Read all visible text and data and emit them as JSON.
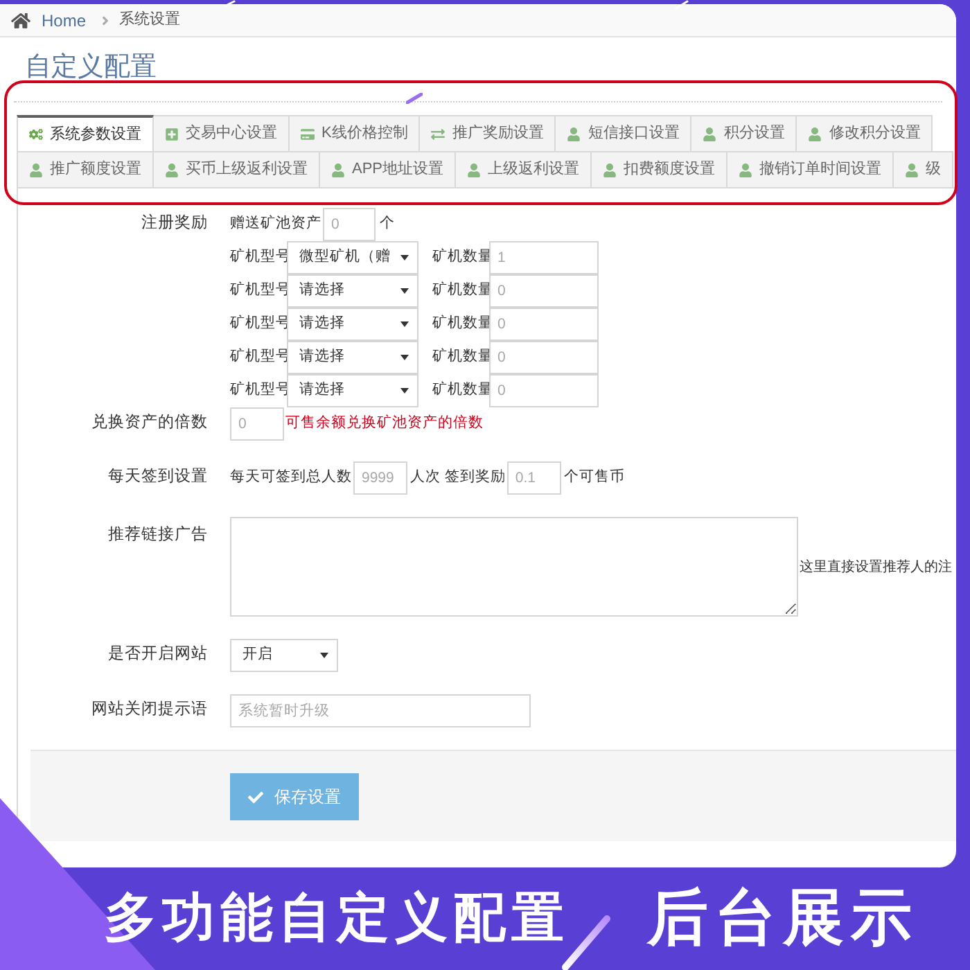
{
  "breadcrumb": [
    {
      "kind": "home",
      "label": "Home"
    },
    {
      "kind": "current",
      "label": "系统设置"
    }
  ],
  "page_title": "自定义配置",
  "tab_rows": [
    {
      "tabs": [
        {
          "kind": "settings",
          "label": "系统参数设置",
          "selected": true
        },
        {
          "kind": "trade",
          "label": "交易中心设置",
          "selected": false
        },
        {
          "kind": "price",
          "label": "K线价格控制",
          "selected": false
        },
        {
          "kind": "promotion",
          "label": "推广奖励设置",
          "selected": false
        },
        {
          "kind": "user",
          "label": "短信接口设置",
          "selected": false
        },
        {
          "kind": "user",
          "label": "积分设置",
          "selected": false
        },
        {
          "kind": "user",
          "label": "修改积分设置",
          "selected": false
        }
      ]
    },
    {
      "tabs": [
        {
          "kind": "user",
          "label": "推广额度设置",
          "selected": false
        },
        {
          "kind": "user",
          "label": "买币上级返利设置",
          "selected": false
        },
        {
          "kind": "user",
          "label": "APP地址设置",
          "selected": false
        },
        {
          "kind": "user",
          "label": "上级返利设置",
          "selected": false
        },
        {
          "kind": "user",
          "label": "扣费额度设置",
          "selected": false
        },
        {
          "kind": "user",
          "label": "撤销订单时间设置",
          "selected": false
        },
        {
          "kind": "user",
          "label": "级",
          "selected": false
        }
      ]
    }
  ],
  "form": {
    "register_reward": {
      "label": "注册奖励",
      "gift_prefix": "赠送矿池资产",
      "gift_field": {
        "placeholder": "0"
      },
      "gift_suffix": "个",
      "machines": [
        {
          "type_label": "矿机型号",
          "type_select": "微型矿机（赠",
          "count_label": "矿机数量",
          "count_field": {
            "placeholder": "1"
          }
        },
        {
          "type_label": "矿机型号",
          "type_select": "请选择",
          "count_label": "矿机数量",
          "count_field": {
            "placeholder": "0"
          }
        },
        {
          "type_label": "矿机型号",
          "type_select": "请选择",
          "count_label": "矿机数量",
          "count_field": {
            "placeholder": "0"
          }
        },
        {
          "type_label": "矿机型号",
          "type_select": "请选择",
          "count_label": "矿机数量",
          "count_field": {
            "placeholder": "0"
          }
        },
        {
          "type_label": "矿机型号",
          "type_select": "请选择",
          "count_label": "矿机数量",
          "count_field": {
            "placeholder": "0"
          }
        }
      ]
    },
    "exchange_multiple": {
      "label": "兑换资产的倍数",
      "field": {
        "placeholder": "0"
      },
      "hint": "可售余额兑换矿池资产的倍数"
    },
    "daily_checkin": {
      "label": "每天签到设置",
      "total_prefix": "每天可签到总人数",
      "total_field": {
        "placeholder": "9999"
      },
      "reward_prefix": "人次 签到奖励",
      "reward_field": {
        "placeholder": "0.1"
      },
      "reward_suffix": "个可售币"
    },
    "referral_ad": {
      "label": "推荐链接广告",
      "note": "这里直接设置推荐人的注"
    },
    "site_open": {
      "label": "是否开启网站",
      "select": "开启"
    },
    "close_message": {
      "label": "网站关闭提示语",
      "field": {
        "placeholder": "系统暂时升级"
      }
    }
  },
  "save_button": "保存设置",
  "banner": {
    "headline": "多功能自定义配置",
    "tagline": "后台展示"
  }
}
